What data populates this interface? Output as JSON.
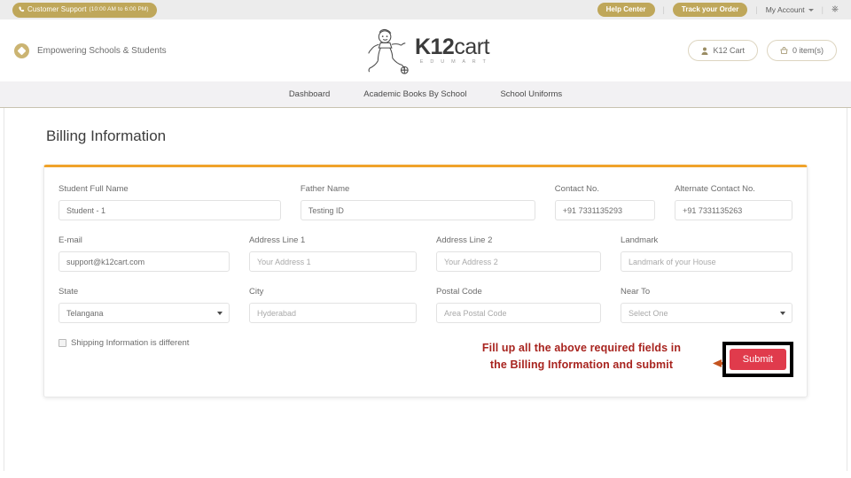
{
  "topbar": {
    "support_icon": "phone-icon",
    "support_label": "Customer Support",
    "support_hours": "(10:00 AM to 6:00 PM)",
    "help_center": "Help Center",
    "track_order": "Track your Order",
    "my_account": "My Account",
    "power_icon": "power-icon",
    "accent": "#bfa75a",
    "background": "#ececec"
  },
  "header": {
    "badge_icon": "diamond-badge-icon",
    "tagline": "Empowering Schools & Students",
    "logo": {
      "mark": "mascot-icon",
      "name_bold": "K12",
      "name_light": "cart",
      "subtitle": "E D U M A R T"
    },
    "account_button": {
      "icon": "user-icon",
      "label": "K12 Cart"
    },
    "cart_button": {
      "icon": "cart-icon",
      "label": "0 item(s)"
    }
  },
  "nav": {
    "items": [
      {
        "label": "Dashboard"
      },
      {
        "label": "Academic Books By School"
      },
      {
        "label": "School Uniforms"
      }
    ]
  },
  "main": {
    "page_title": "Billing Information",
    "card_accent": "#f0a32a",
    "rows": [
      {
        "fields": [
          {
            "label": "Student Full Name",
            "value": "Student - 1",
            "placeholder": "Student Full Name",
            "type": "text",
            "filled": true
          },
          {
            "label": "Father Name",
            "value": "Testing ID",
            "placeholder": "Father Name",
            "type": "text",
            "filled": true
          },
          {
            "label": "Contact No.",
            "value": "+91 7331135293",
            "placeholder": "Contact No.",
            "type": "text",
            "filled": true
          },
          {
            "label": "Alternate Contact No.",
            "value": "+91 7331135263",
            "placeholder": "Alternate Contact No.",
            "type": "text",
            "filled": true
          }
        ]
      },
      {
        "fields": [
          {
            "label": "E-mail",
            "value": "support@k12cart.com",
            "placeholder": "E-mail",
            "type": "text",
            "filled": true
          },
          {
            "label": "Address Line 1",
            "value": "Your Address 1",
            "placeholder": "Your Address 1",
            "type": "text",
            "filled": false
          },
          {
            "label": "Address Line 2",
            "value": "Your Address 2",
            "placeholder": "Your Address 2",
            "type": "text",
            "filled": false
          },
          {
            "label": "Landmark",
            "value": "Landmark of your House",
            "placeholder": "Landmark of your House",
            "type": "text",
            "filled": false
          }
        ]
      },
      {
        "fields": [
          {
            "label": "State",
            "value": "Telangana",
            "placeholder": "Select One",
            "type": "select",
            "filled": true
          },
          {
            "label": "City",
            "value": "Hyderabad",
            "placeholder": "Hyderabad",
            "type": "text",
            "filled": false
          },
          {
            "label": "Postal Code",
            "value": "Area Postal Code",
            "placeholder": "Area Postal Code",
            "type": "text",
            "filled": false
          },
          {
            "label": "Near To",
            "value": "Select One",
            "placeholder": "Select One",
            "type": "select",
            "filled": false
          }
        ]
      }
    ],
    "shipping_checkbox": {
      "label": "Shipping Information is different",
      "checked": false
    },
    "annotation": {
      "line1": "Fill up all the above required fields  in",
      "line2": "the Billing Information and submit",
      "color": "#a8241f",
      "arrow_icon": "left-arrow-annotation",
      "arrow_color": "#c4541f"
    },
    "submit": {
      "label": "Submit",
      "color": "#e03b4c",
      "highlight_color": "#000000"
    }
  }
}
